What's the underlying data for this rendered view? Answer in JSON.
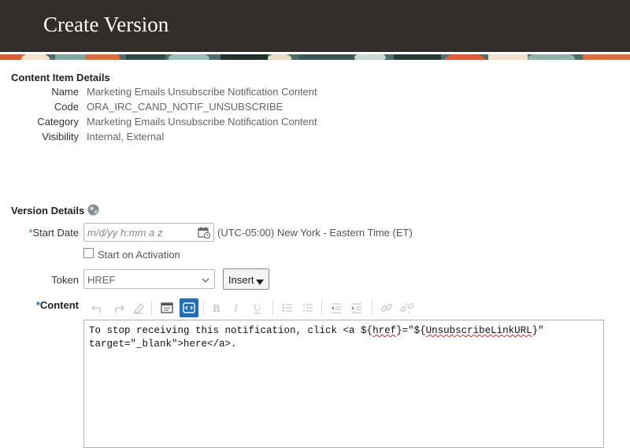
{
  "page": {
    "title": "Create Version"
  },
  "content_item_details": {
    "heading": "Content Item Details",
    "rows": [
      {
        "label": "Name",
        "value": "Marketing Emails Unsubscribe Notification Content"
      },
      {
        "label": "Code",
        "value": "ORA_IRC_CAND_NOTIF_UNSUBSCRIBE"
      },
      {
        "label": "Category",
        "value": "Marketing Emails Unsubscribe Notification Content"
      },
      {
        "label": "Visibility",
        "value": "Internal, External"
      }
    ]
  },
  "version_details": {
    "heading": "Version Details",
    "required_marker": "*",
    "start_date": {
      "label": "Start Date",
      "placeholder": "m/d/yy h:mm a z",
      "timezone": "(UTC-05:00) New York - Eastern Time (ET)"
    },
    "start_on_activation": {
      "label": "Start on Activation",
      "checked": false
    },
    "token": {
      "label": "Token",
      "value": "HREF",
      "insert_label": "Insert"
    },
    "content": {
      "label": "Content",
      "line1_prefix": "To stop receiving this notification, click <a ${",
      "line1_word1": "href",
      "line1_mid": "}=\"${",
      "line1_word2": "UnsubscribeLinkURL",
      "line1_suffix": "}\"",
      "line2": "target=\"_blank\">here</a>."
    }
  },
  "toolbar": {
    "icons": [
      "undo-icon",
      "redo-icon",
      "clear-format-icon",
      "source-view-icon",
      "rich-text-toggle-icon",
      "bold-icon",
      "italic-icon",
      "underline-icon",
      "bullet-list-icon",
      "numbered-list-icon",
      "outdent-icon",
      "indent-icon",
      "link-icon",
      "unlink-icon"
    ]
  },
  "colors": {
    "header_bg": "#312d2a",
    "required": "#1a6fbf",
    "active_toggle": "#1f6fb5"
  }
}
